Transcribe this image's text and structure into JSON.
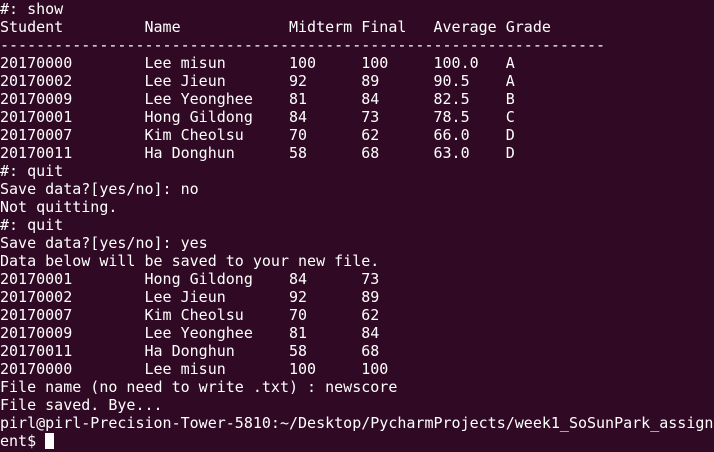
{
  "terminal": {
    "lines": [
      "#: show",
      "Student         Name            Midterm Final   Average Grade",
      "-------------------------------------------------------------------",
      "20170000        Lee misun       100     100     100.0   A",
      "20170002        Lee Jieun       92      89      90.5    A",
      "20170009        Lee Yeonghee    81      84      82.5    B",
      "20170001        Hong Gildong    84      73      78.5    C",
      "20170007        Kim Cheolsu     70      62      66.0    D",
      "20170011        Ha Donghun      58      68      63.0    D",
      "#: quit",
      "Save data?[yes/no]: no",
      "Not quitting.",
      "#: quit",
      "Save data?[yes/no]: yes",
      "Data below will be saved to your new file.",
      "20170001        Hong Gildong    84      73",
      "20170002        Lee Jieun       92      89",
      "20170007        Kim Cheolsu     70      62",
      "20170009        Lee Yeonghee    81      84",
      "20170011        Ha Donghun      58      68",
      "20170000        Lee misun       100     100",
      "File name (no need to write .txt) : newscore",
      "File saved. Bye...",
      "pirl@pirl-Precision-Tower-5810:~/Desktop/PycharmProjects/week1_SoSunPark_assignm"
    ],
    "prompt_tail": "ent$ "
  },
  "colors": {
    "background": "#300a24",
    "foreground": "#ffffff"
  }
}
